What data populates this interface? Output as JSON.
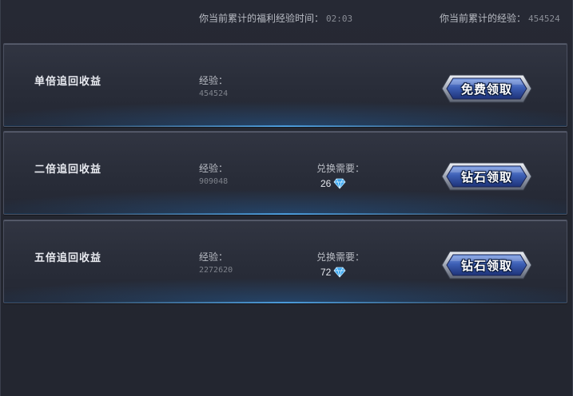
{
  "header": {
    "time_label": "你当前累计的福利经验时间：",
    "time_value": "02:03",
    "exp_label": "你当前累计的经验：",
    "exp_value": "454524"
  },
  "rows": [
    {
      "title": "单倍追回收益",
      "exp_label": "经验：",
      "exp_value": "454524",
      "cost_label": "",
      "cost_value": "",
      "button_label": "免费领取",
      "cost_icon": "diamond-icon"
    },
    {
      "title": "二倍追回收益",
      "exp_label": "经验：",
      "exp_value": "909048",
      "cost_label": "兑换需要：",
      "cost_value": "26",
      "button_label": "钻石领取",
      "cost_icon": "diamond-icon"
    },
    {
      "title": "五倍追回收益",
      "exp_label": "经验：",
      "exp_value": "2272620",
      "cost_label": "兑换需要：",
      "cost_value": "72",
      "button_label": "钻石领取",
      "cost_icon": "diamond-icon"
    }
  ],
  "colors": {
    "background": "#252832",
    "panel": "#2a2e3a",
    "accent_glow": "#50aaf0",
    "button_fill": "#3f62b8",
    "button_frame": "#c9ced8"
  }
}
